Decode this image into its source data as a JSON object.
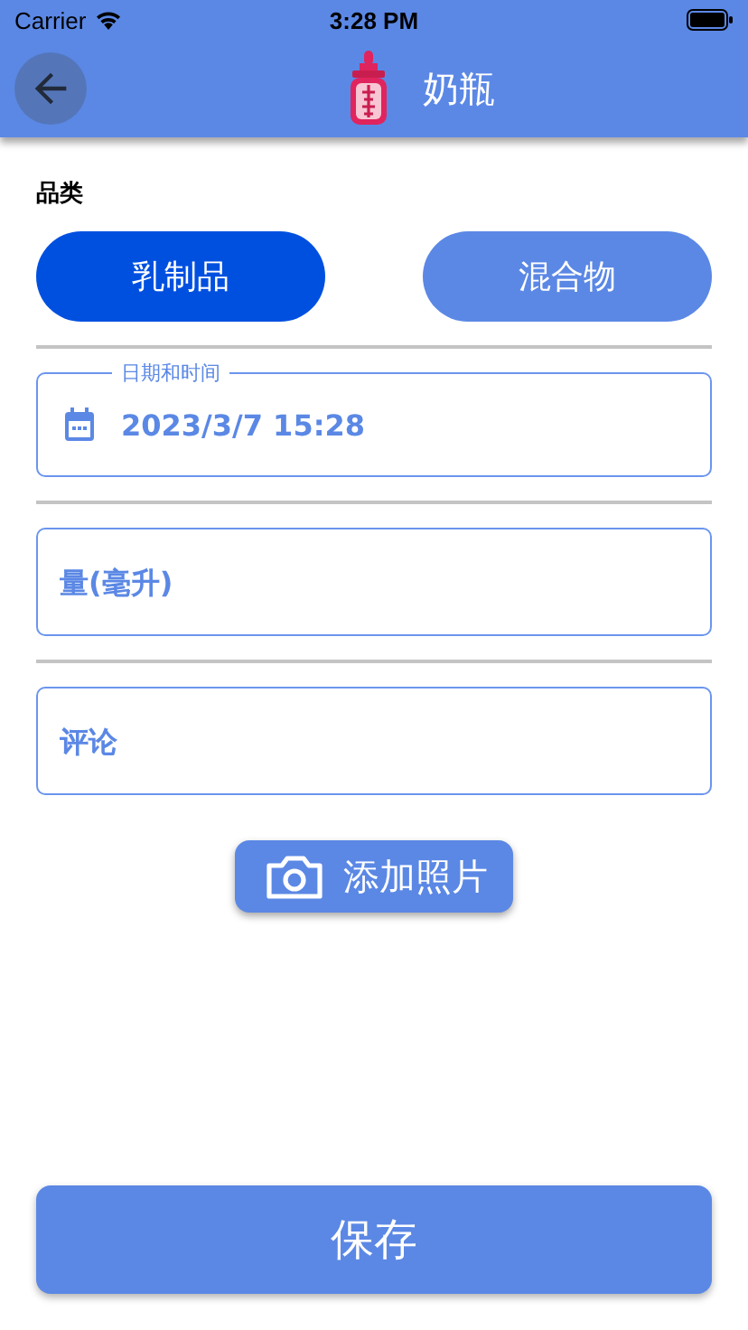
{
  "status_bar": {
    "carrier": "Carrier",
    "time": "3:28 PM"
  },
  "header": {
    "title": "奶瓶"
  },
  "category": {
    "label": "品类",
    "options": [
      {
        "label": "乳制品",
        "selected": true
      },
      {
        "label": "混合物",
        "selected": false
      }
    ]
  },
  "date_field": {
    "label": "日期和时间",
    "value": "2023/3/7 15:28"
  },
  "amount_field": {
    "placeholder": "量(毫升)"
  },
  "comment_field": {
    "placeholder": "评论"
  },
  "photo_button": "添加照片",
  "save_button": "保存"
}
